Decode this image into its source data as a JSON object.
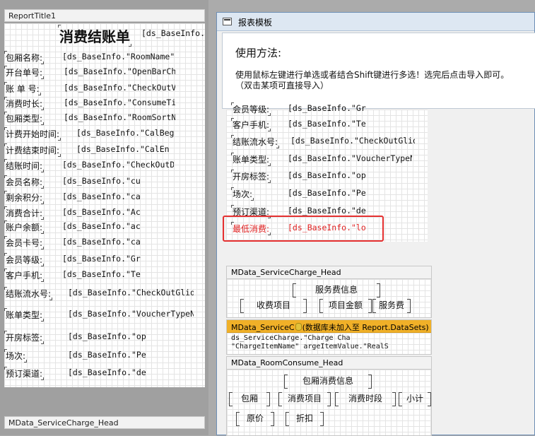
{
  "left_panel": {
    "band_title": "ReportTitle1",
    "report_title": "消费结账单",
    "title_field": "[ds_BaseInfo.",
    "rows": [
      {
        "label": "包厢名称:",
        "field": "[ds_BaseInfo.\"RoomName\""
      },
      {
        "label": "开台单号:",
        "field": "[ds_BaseInfo.\"OpenBarCh"
      },
      {
        "label": "账 单 号:",
        "field": "[ds_BaseInfo.\"CheckOutV"
      },
      {
        "label": "消费时长:",
        "field": "[ds_BaseInfo.\"ConsumeTi"
      },
      {
        "label": "包厢类型:",
        "field": "[ds_BaseInfo.\"RoomSortN"
      },
      {
        "label": "计费开始时间:",
        "field": "[ds_BaseInfo.\"CalBeg"
      },
      {
        "label": "计费结束时间:",
        "field": "[ds_BaseInfo.\"CalEn"
      },
      {
        "label": "结账时间:",
        "field": "[ds_BaseInfo.\"CheckOutD"
      },
      {
        "label": "会员名称:",
        "field": "[ds_BaseInfo.\"cu"
      },
      {
        "label": "剩余积分:",
        "field": "[ds_BaseInfo.\"ca"
      },
      {
        "label": "消费合计:",
        "field": "[ds_BaseInfo.\"Ac"
      },
      {
        "label": "账户余额:",
        "field": "[ds_BaseInfo.\"ac"
      },
      {
        "label": "会员卡号:",
        "field": "[ds_BaseInfo.\"ca"
      },
      {
        "label": "会员等级:",
        "field": "[ds_BaseInfo.\"Gr"
      },
      {
        "label": "客户手机:",
        "field": "[ds_BaseInfo.\"Te"
      },
      {
        "label": "结账流水号:",
        "field": "[ds_BaseInfo.\"CheckOutGlid"
      },
      {
        "label": "账单类型:",
        "field": "[ds_BaseInfo.\"VoucherTypeN"
      },
      {
        "label": "开房标签:",
        "field": "[ds_BaseInfo.\"op"
      },
      {
        "label": "场次:",
        "field": "[ds_BaseInfo.\"Pe"
      },
      {
        "label": "预订渠道:",
        "field": "[ds_BaseInfo.\"de"
      }
    ],
    "bottom_band_title": "MData_ServiceCharge_Head"
  },
  "dialog": {
    "title": "报表模板",
    "instructions_title": "使用方法:",
    "instructions_line1": "使用鼠标左键进行单选或者结合Shift键进行多选！选完后点击导入即可。",
    "instructions_line2": "（双击某项可直接导入）",
    "rows": [
      {
        "label": "会员等级:",
        "field": "[ds_BaseInfo.\"Gr"
      },
      {
        "label": "客户手机:",
        "field": "[ds_BaseInfo.\"Te"
      },
      {
        "label": "结账流水号:",
        "field": "[ds_BaseInfo.\"CheckOutGlid"
      },
      {
        "label": "账单类型:",
        "field": "[ds_BaseInfo.\"VoucherTypeN"
      },
      {
        "label": "开房标签:",
        "field": "[ds_BaseInfo.\"op"
      },
      {
        "label": "场次:",
        "field": "[ds_BaseInfo.\"Pe"
      },
      {
        "label": "预订渠道:",
        "field": "[ds_BaseInfo.\"de"
      },
      {
        "label": "最低消费:",
        "field": "[ds_BaseInfo.\"lo"
      }
    ],
    "service_head": {
      "title": "MData_ServiceCharge_Head",
      "group": "服务费信息",
      "cols": [
        "收费项目",
        "项目金额",
        "服务费"
      ]
    },
    "service_data": {
      "title_prefix": "MData_ServiceC",
      "title_suffix": "(数据库未加入至 Report.DataSets)",
      "line1": "ds_ServiceCharge.\"Charge  Cha",
      "line2": "\"ChargeItemName\"  argeItemValue.\"RealS"
    },
    "room_head": {
      "title": "MData_RoomConsume_Head",
      "group": "包厢消费信息",
      "cols1": [
        "包厢",
        "消费项目",
        "消费时段",
        "小计"
      ],
      "cols2": [
        "原价",
        "折扣"
      ]
    }
  }
}
